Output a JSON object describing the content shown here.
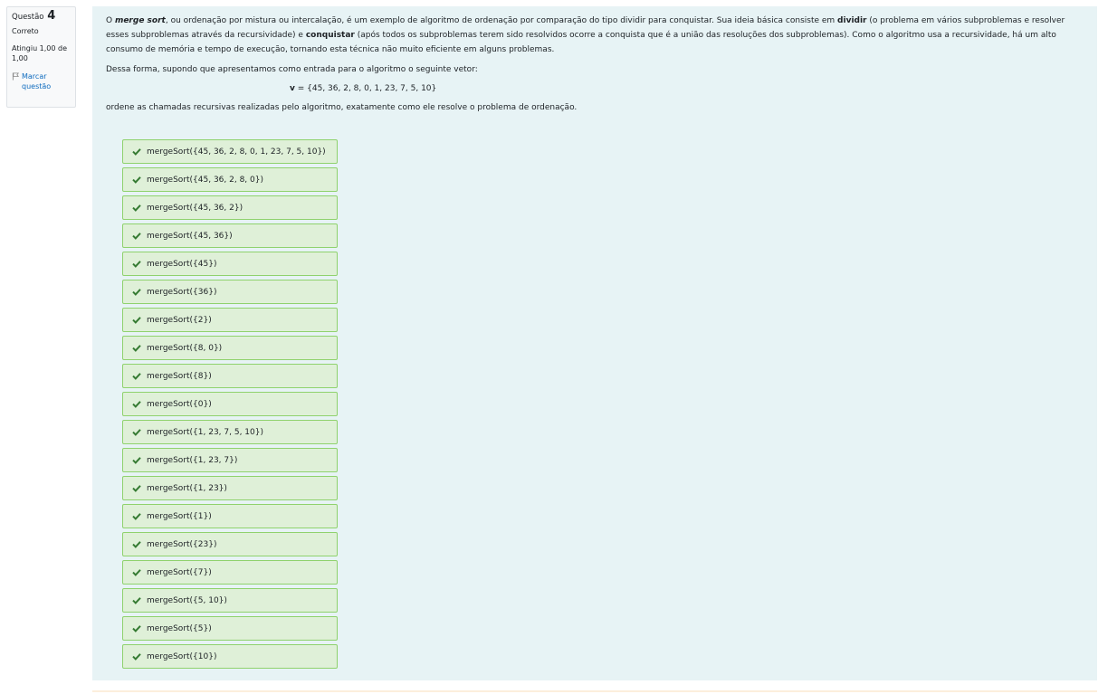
{
  "info": {
    "question_label": "Questão",
    "question_number": "4",
    "state": "Correto",
    "grade": "Atingiu 1,00 de 1,00",
    "flag_label": "Marcar questão"
  },
  "question": {
    "p1": {
      "t0": "O ",
      "t1": "merge sort",
      "t2": ", ou ordenação por mistura ou intercalação, é um exemplo de algoritmo de ordenação por comparação do tipo dividir para conquistar. Sua ideia básica consiste em ",
      "t3": "dividir",
      "t4": " (o problema em vários subproblemas e resolver esses subproblemas através da recursividade) e ",
      "t5": "conquistar",
      "t6": " (após todos os subproblemas terem sido resolvidos ocorre a conquista que é a união das resoluções dos subproblemas). Como o algoritmo usa a recursividade, há um alto consumo de memória e tempo de execução, tornando esta técnica não muito eficiente em alguns problemas."
    },
    "p2": "Dessa forma, supondo que apresentamos como entrada para o algoritmo o seguinte vetor:",
    "vector_name": "v",
    "vector_value": " = {45, 36, 2, 8, 0, 1, 23, 7, 5, 10}",
    "p3": "ordene as chamadas recursivas realizadas pelo algoritmo, exatamente como ele resolve o problema de ordenação."
  },
  "answers": [
    "mergeSort({45, 36, 2, 8, 0, 1, 23, 7, 5, 10})",
    "mergeSort({45, 36, 2, 8, 0})",
    "mergeSort({45, 36, 2})",
    "mergeSort({45, 36})",
    "mergeSort({45})",
    "mergeSort({36})",
    "mergeSort({2})",
    "mergeSort({8, 0})",
    "mergeSort({8})",
    "mergeSort({0})",
    "mergeSort({1, 23, 7, 5, 10})",
    "mergeSort({1, 23, 7})",
    "mergeSort({1, 23})",
    "mergeSort({1})",
    "mergeSort({23})",
    "mergeSort({7})",
    "mergeSort({5, 10})",
    "mergeSort({5})",
    "mergeSort({10})"
  ],
  "colors": {
    "correct_check": "#357a32",
    "answer_bg": "#dff0d8",
    "answer_border": "#8fd26d",
    "content_bg": "#e7f3f5",
    "flag": "#0f6cbf"
  },
  "icons": {
    "answer": "check-icon",
    "flag": "flag-icon"
  }
}
